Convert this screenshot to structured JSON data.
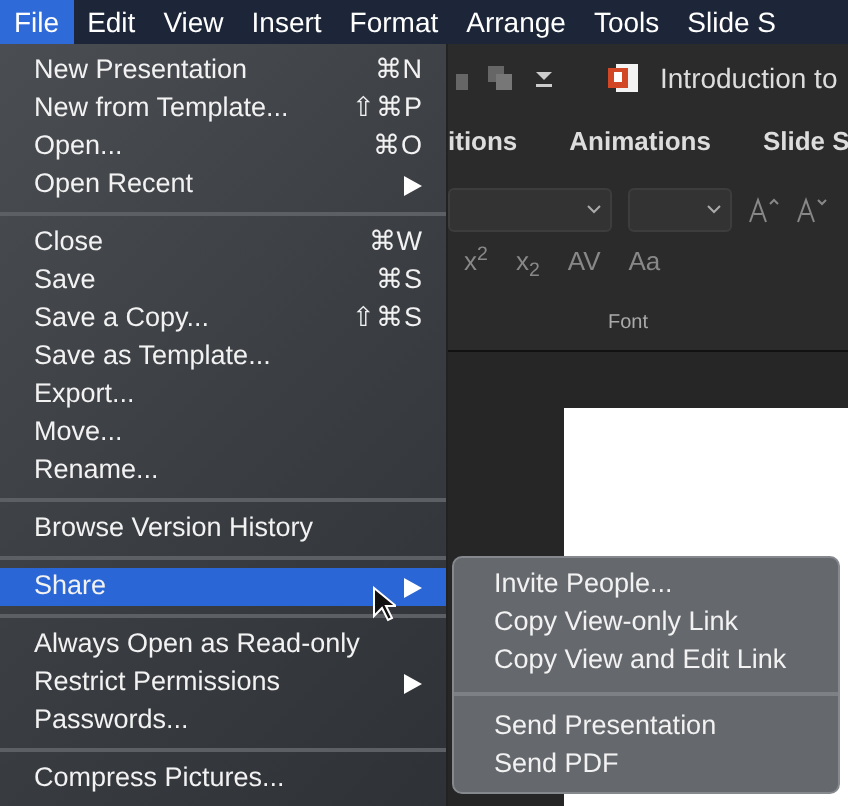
{
  "menubar": [
    {
      "label": "File",
      "selected": true
    },
    {
      "label": "Edit",
      "selected": false
    },
    {
      "label": "View",
      "selected": false
    },
    {
      "label": "Insert",
      "selected": false
    },
    {
      "label": "Format",
      "selected": false
    },
    {
      "label": "Arrange",
      "selected": false
    },
    {
      "label": "Tools",
      "selected": false
    },
    {
      "label": "Slide S",
      "selected": false
    }
  ],
  "file_menu": [
    {
      "kind": "item",
      "label": "New Presentation",
      "shortcut": "⌘N",
      "selected": false
    },
    {
      "kind": "item",
      "label": "New from Template...",
      "shortcut": "⇧⌘P",
      "selected": false
    },
    {
      "kind": "item",
      "label": "Open...",
      "shortcut": "⌘O",
      "selected": false
    },
    {
      "kind": "submenu",
      "label": "Open Recent",
      "selected": false
    },
    {
      "kind": "separator"
    },
    {
      "kind": "item",
      "label": "Close",
      "shortcut": "⌘W",
      "selected": false
    },
    {
      "kind": "item",
      "label": "Save",
      "shortcut": "⌘S",
      "selected": false
    },
    {
      "kind": "item",
      "label": "Save a Copy...",
      "shortcut": "⇧⌘S",
      "selected": false
    },
    {
      "kind": "item",
      "label": "Save as Template...",
      "selected": false
    },
    {
      "kind": "item",
      "label": "Export...",
      "selected": false
    },
    {
      "kind": "item",
      "label": "Move...",
      "selected": false
    },
    {
      "kind": "item",
      "label": "Rename...",
      "selected": false
    },
    {
      "kind": "separator"
    },
    {
      "kind": "item",
      "label": "Browse Version History",
      "selected": false
    },
    {
      "kind": "separator"
    },
    {
      "kind": "submenu",
      "label": "Share",
      "selected": true
    },
    {
      "kind": "separator"
    },
    {
      "kind": "item",
      "label": "Always Open as Read-only",
      "selected": false
    },
    {
      "kind": "submenu",
      "label": "Restrict Permissions",
      "selected": false
    },
    {
      "kind": "item",
      "label": "Passwords...",
      "selected": false
    },
    {
      "kind": "separator"
    },
    {
      "kind": "item",
      "label": "Compress Pictures...",
      "selected": false
    }
  ],
  "share_submenu": [
    {
      "kind": "item",
      "label": "Invite People..."
    },
    {
      "kind": "item",
      "label": "Copy View-only Link"
    },
    {
      "kind": "item",
      "label": "Copy View and Edit Link"
    },
    {
      "kind": "separator"
    },
    {
      "kind": "item",
      "label": "Send Presentation"
    },
    {
      "kind": "item",
      "label": "Send PDF"
    }
  ],
  "app": {
    "title": "Introduction to",
    "tabs": [
      "itions",
      "Animations",
      "Slide S"
    ],
    "ribbon_row": [
      "x$^{2}$",
      "x$_{2}$",
      "AV",
      "Aa"
    ],
    "group_label": "Font"
  }
}
